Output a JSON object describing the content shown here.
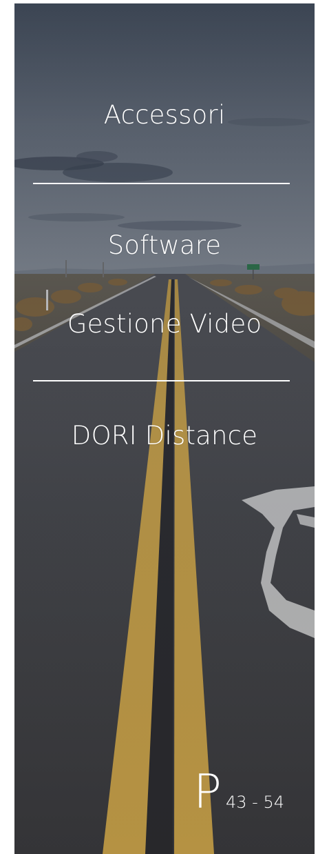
{
  "menu": {
    "items": [
      {
        "label": "Accessori"
      },
      {
        "label": "Software"
      },
      {
        "label": "Gestione Video"
      },
      {
        "label": "DORI Distance"
      }
    ]
  },
  "pages": {
    "letter": "P",
    "range": "43 - 54"
  },
  "colors": {
    "text": "#ffffff",
    "asphalt": "#3f3f42",
    "road_line_yellow": "#c9a24a",
    "sky": "#7c8591"
  },
  "background": {
    "icon": "road-photo"
  }
}
